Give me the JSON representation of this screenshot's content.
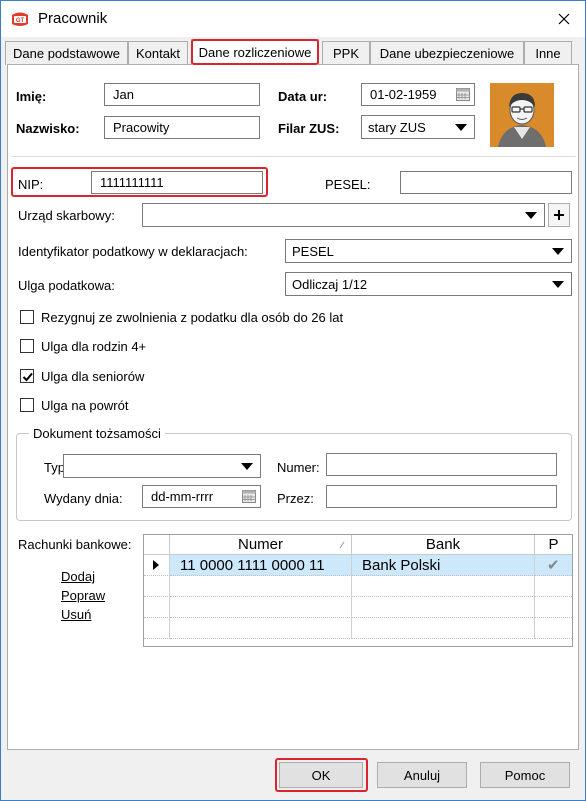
{
  "window": {
    "title": "Pracownik"
  },
  "tabs": [
    "Dane podstawowe",
    "Kontakt",
    "Dane rozliczeniowe",
    "PPK",
    "Dane ubezpieczeniowe",
    "Inne"
  ],
  "form": {
    "imie_label": "Imię:",
    "imie_value": "Jan",
    "nazwisko_label": "Nazwisko:",
    "nazwisko_value": "Pracowity",
    "data_ur_label": "Data ur:",
    "data_ur_value": "01-02-1959",
    "filar_label": "Filar ZUS:",
    "filar_value": "stary ZUS",
    "nip_label": "NIP:",
    "nip_value": "1111111111",
    "pesel_label": "PESEL:",
    "pesel_value": "",
    "urzad_label": "Urząd skarbowy:",
    "urzad_value": "",
    "identyfikator_label": "Identyfikator podatkowy w deklaracjach:",
    "identyfikator_value": "PESEL",
    "ulga_label": "Ulga podatkowa:",
    "ulga_value": "Odliczaj 1/12"
  },
  "checkboxes": [
    {
      "label": "Rezygnuj ze zwolnienia z podatku dla osób do 26 lat",
      "checked": false
    },
    {
      "label": "Ulga dla rodzin 4+",
      "checked": false
    },
    {
      "label": "Ulga dla seniorów",
      "checked": true
    },
    {
      "label": "Ulga na powrót",
      "checked": false
    }
  ],
  "dokument": {
    "title": "Dokument tożsamości",
    "typ_label": "Typ:",
    "typ_value": "",
    "numer_label": "Numer:",
    "numer_value": "",
    "wydany_label": "Wydany dnia:",
    "wydany_value": "dd-mm-rrrr",
    "przez_label": "Przez:",
    "przez_value": ""
  },
  "bank": {
    "label": "Rachunki bankowe:",
    "links": [
      "Dodaj",
      "Popraw",
      "Usuń"
    ],
    "columns": [
      "Numer",
      "Bank",
      "P"
    ],
    "rows": [
      {
        "numer": "11 0000 1111 0000 11",
        "bank": "Bank Polski",
        "p": "✔"
      }
    ]
  },
  "buttons": {
    "ok": "OK",
    "cancel": "Anuluj",
    "help": "Pomoc"
  },
  "colors": {
    "highlight": "#d9252f",
    "selection": "#cde8fb",
    "photo_bg": "#d98a2a"
  }
}
